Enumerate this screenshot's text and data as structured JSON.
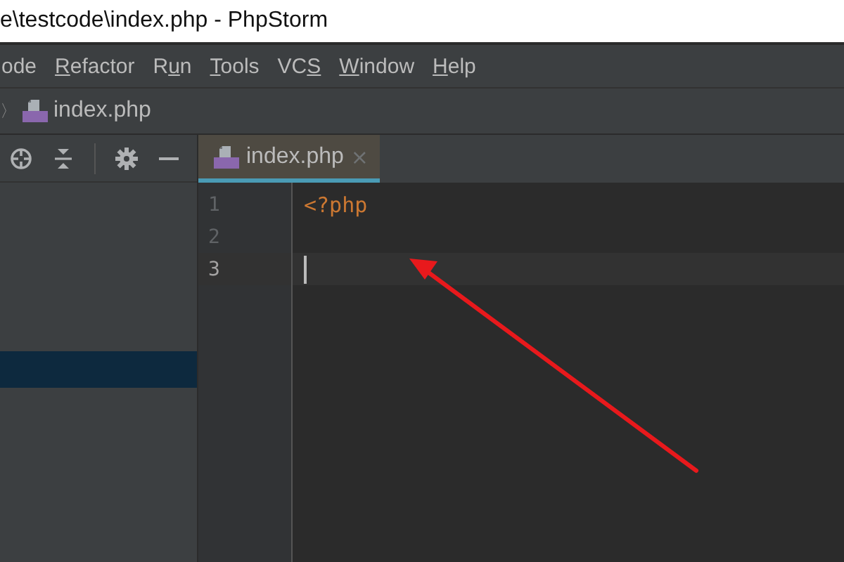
{
  "window": {
    "title": "e\\testcode\\index.php - PhpStorm"
  },
  "menu": [
    {
      "after": "ode"
    },
    {
      "key": "R",
      "after": "efactor"
    },
    {
      "before": "R",
      "key": "u",
      "after": "n"
    },
    {
      "key": "T",
      "after": "ools"
    },
    {
      "before": "VC",
      "key": "S"
    },
    {
      "key": "W",
      "after": "indow"
    },
    {
      "key": "H",
      "after": "elp"
    }
  ],
  "breadcrumb": {
    "separator": "〉",
    "file": "index.php"
  },
  "project_panel": {
    "rows": [
      {
        "selected": false
      },
      {
        "selected": false
      },
      {
        "selected": false
      },
      {
        "selected": false
      },
      {
        "selected": true
      },
      {
        "selected": false
      }
    ]
  },
  "tabs": [
    {
      "label": "index.php",
      "close": "×",
      "selected": true
    }
  ],
  "editor": {
    "lines": [
      {
        "number": "1",
        "code": "<?php",
        "current": false
      },
      {
        "number": "2",
        "current": false
      },
      {
        "number": "3",
        "current": true
      }
    ]
  },
  "annotation": {
    "kind": "arrow"
  }
}
